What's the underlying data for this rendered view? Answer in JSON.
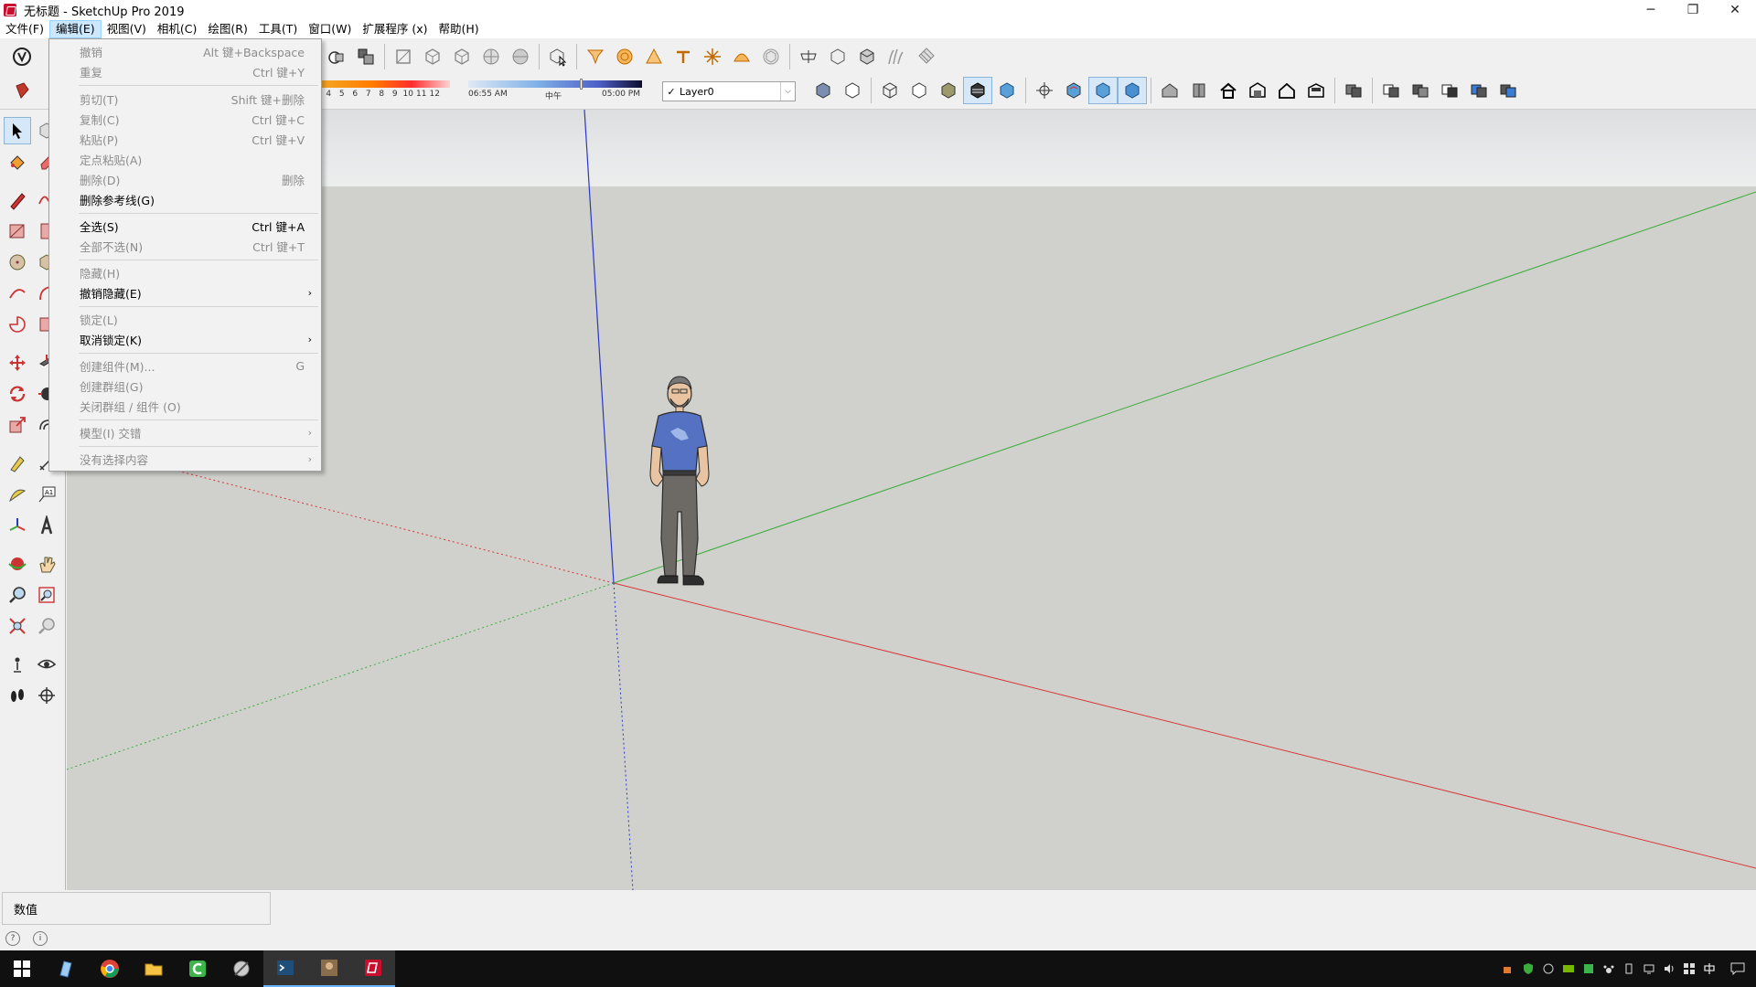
{
  "window": {
    "title": "无标题 - SketchUp Pro 2019",
    "minimize_glyph": "─",
    "restore_glyph": "❐",
    "close_glyph": "✕"
  },
  "menubar": {
    "items": [
      "文件(F)",
      "编辑(E)",
      "视图(V)",
      "相机(C)",
      "绘图(R)",
      "工具(T)",
      "窗口(W)",
      "扩展程序 (x)",
      "帮助(H)"
    ],
    "active_index": 1
  },
  "edit_menu": {
    "items": [
      {
        "label": "撤销",
        "shortcut": "Alt 键+Backspace",
        "enabled": false
      },
      {
        "label": "重复",
        "shortcut": "Ctrl 键+Y",
        "enabled": false
      },
      {
        "label": "剪切(T)",
        "shortcut": "Shift 键+删除",
        "enabled": false
      },
      {
        "label": "复制(C)",
        "shortcut": "Ctrl 键+C",
        "enabled": false
      },
      {
        "label": "粘贴(P)",
        "shortcut": "Ctrl 键+V",
        "enabled": false
      },
      {
        "label": "定点粘贴(A)",
        "shortcut": "",
        "enabled": false
      },
      {
        "label": "删除(D)",
        "shortcut": "删除",
        "enabled": false
      },
      {
        "label": "删除参考线(G)",
        "shortcut": "",
        "enabled": true
      },
      {
        "label": "全选(S)",
        "shortcut": "Ctrl 键+A",
        "enabled": true
      },
      {
        "label": "全部不选(N)",
        "shortcut": "Ctrl 键+T",
        "enabled": false
      },
      {
        "label": "隐藏(H)",
        "shortcut": "",
        "enabled": false
      },
      {
        "label": "撤销隐藏(E)",
        "shortcut": "",
        "enabled": true,
        "submenu": true
      },
      {
        "label": "锁定(L)",
        "shortcut": "",
        "enabled": false
      },
      {
        "label": "取消锁定(K)",
        "shortcut": "",
        "enabled": true,
        "submenu": true
      },
      {
        "label": "创建组件(M)...",
        "shortcut": "G",
        "enabled": false
      },
      {
        "label": "创建群组(G)",
        "shortcut": "",
        "enabled": false
      },
      {
        "label": "关闭群组 / 组件 (O)",
        "shortcut": "",
        "enabled": false
      },
      {
        "label": "模型(I) 交错",
        "shortcut": "",
        "enabled": false,
        "submenu": true
      },
      {
        "label": "没有选择内容",
        "shortcut": "",
        "enabled": false,
        "submenu": true
      }
    ],
    "submenu_arrow": "›"
  },
  "shadow_settings": {
    "month_labels": [
      "4",
      "5",
      "6",
      "7",
      "8",
      "9",
      "10",
      "11",
      "12"
    ],
    "time_start": "06:55 AM",
    "time_mid": "中午",
    "time_end": "05:00 PM"
  },
  "layer": {
    "check": "✓",
    "current": "Layer0",
    "arrow": "⌵"
  },
  "status": {
    "measurements_label": "数值",
    "info_glyph": "i",
    "geo_glyph": "?"
  },
  "colors": {
    "red_axis": "#d93838",
    "green_axis": "#3aad3a",
    "blue_axis": "#2a38c8",
    "viewport_bg": "#d0d0cc",
    "menu_highlight": "#cce8ff"
  }
}
